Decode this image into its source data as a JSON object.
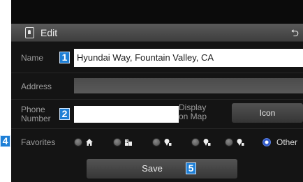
{
  "header": {
    "title": "Edit",
    "edit_icon": "document-icon",
    "back_icon": "back-arrow-icon"
  },
  "form": {
    "name_label": "Name",
    "name_value": "Hyundai Way, Fountain Valley, CA",
    "address_label": "Address",
    "phone_label_line1": "Phone",
    "phone_label_line2": "Number",
    "phone_value": "",
    "display_label_line1": "Display",
    "display_label_line2": "on Map",
    "icon_button_label": "Icon"
  },
  "favorites": {
    "label": "Favorites",
    "options": [
      {
        "icon": "home-icon",
        "selected": false
      },
      {
        "icon": "building-icon",
        "selected": false
      },
      {
        "icon": "pin-1-icon",
        "selected": false
      },
      {
        "icon": "pin-2-icon",
        "selected": false
      },
      {
        "icon": "pin-3-icon",
        "selected": false
      },
      {
        "icon": "",
        "label": "Other",
        "selected": true
      }
    ]
  },
  "save_button_label": "Save",
  "callouts": [
    "1",
    "2",
    "4",
    "5"
  ],
  "colors": {
    "background": "#141414",
    "header": "#4a4a4a",
    "label": "#9c9c9c",
    "field": "#ffffff",
    "selected_radio": "#2f58c8",
    "callout": "#1e7fd6"
  }
}
